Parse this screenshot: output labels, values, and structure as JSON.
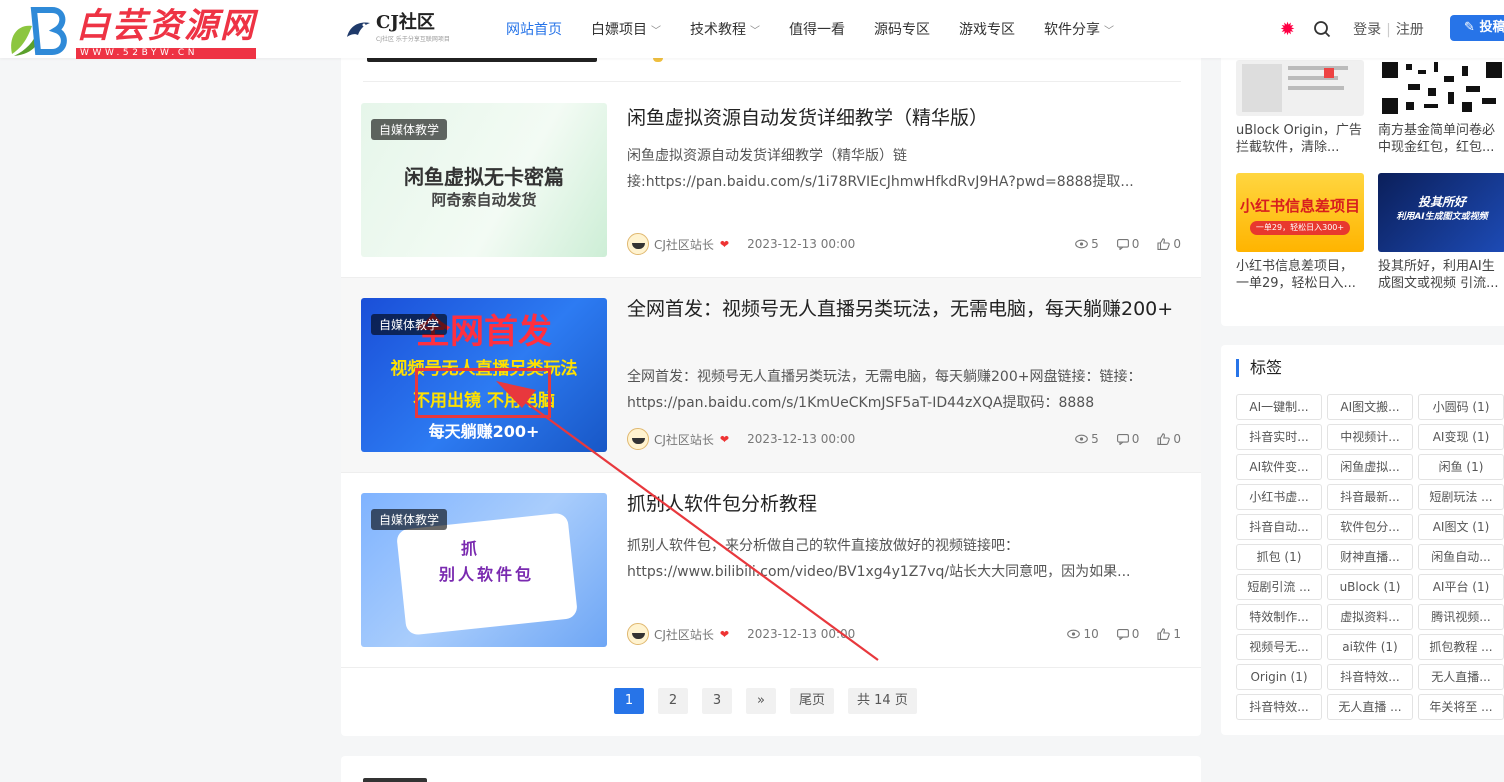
{
  "watermark": {
    "title": "白芸资源网",
    "url": "WWW.52BYW.CN"
  },
  "site": {
    "name": "CJ社区",
    "tagline": "CJ社区 乐于分享互联网项目"
  },
  "nav": {
    "items": [
      {
        "label": "网站首页",
        "dropdown": false
      },
      {
        "label": "白嫖项目",
        "dropdown": true
      },
      {
        "label": "技术教程",
        "dropdown": true
      },
      {
        "label": "值得一看",
        "dropdown": false
      },
      {
        "label": "源码专区",
        "dropdown": false
      },
      {
        "label": "游戏专区",
        "dropdown": false
      },
      {
        "label": "软件分享",
        "dropdown": true
      }
    ]
  },
  "header": {
    "login": "登录",
    "register": "注册",
    "post_button": "投稿"
  },
  "posts": [
    {
      "category": "自媒体教学",
      "thumb_line1": "闲鱼虚拟无卡密篇",
      "thumb_line2": "阿奇索自动发货",
      "title": "闲鱼虚拟资源自动发货详细教学（精华版）",
      "excerpt": "闲鱼虚拟资源自动发货详细教学（精华版）链接:https://pan.baidu.com/s/1i78RVIEcJhmwHfkdRvJ9HA?pwd=8888提取...",
      "author": "CJ社区站长",
      "date": "2023-12-13 00:00",
      "views": "5",
      "comments": "0",
      "likes": "0"
    },
    {
      "category": "自媒体教学",
      "thumb_line1": "全网首发",
      "thumb_line2": "视频号无人直播另类玩法",
      "thumb_line3": "不用出镜 不用电脑",
      "thumb_line4": "每天躺赚200+",
      "title": "全网首发：视频号无人直播另类玩法，无需电脑，每天躺赚200+",
      "excerpt": "全网首发：视频号无人直播另类玩法，无需电脑，每天躺赚200+网盘链接：链接：https://pan.baidu.com/s/1KmUeCKmJSF5aT-ID44zXQA提取码：8888",
      "author": "CJ社区站长",
      "date": "2023-12-13 00:00",
      "views": "5",
      "comments": "0",
      "likes": "0"
    },
    {
      "category": "自媒体教学",
      "thumb_line1": "抓",
      "thumb_line2": "别人软件包",
      "title": "抓别人软件包分析教程",
      "excerpt": "抓别人软件包，来分析做自己的软件直接放做好的视频链接吧：https://www.bilibili.com/video/BV1xg4y1Z7vq/站长大大同意吧，因为如果...",
      "author": "CJ社区站长",
      "date": "2023-12-13 00:00",
      "views": "10",
      "comments": "0",
      "likes": "1"
    }
  ],
  "pagination": {
    "pages": [
      "1",
      "2",
      "3"
    ],
    "next": "»",
    "last": "尾页",
    "total": "共 14 页",
    "current": "1"
  },
  "sidebar": {
    "related": [
      {
        "title": "uBlock Origin，广告拦截软件，清除..."
      },
      {
        "title": "南方基金简单问卷必中现金红包，红包..."
      },
      {
        "title": "小红书信息差项目，一单29，轻松日入...",
        "img_text": "小红书信息差项目",
        "img_sub": "一单29，轻松日入300+"
      },
      {
        "title": "投其所好，利用AI生成图文或视频 引流...",
        "img_text": "投其所好",
        "img_sub": "利用AI生成图文或视频"
      }
    ],
    "tags_title": "标签",
    "tags": [
      "AI一键制...",
      "AI图文搬...",
      "小圆码 (1)",
      "抖音实时...",
      "中视频计...",
      "AI变现 (1)",
      "AI软件变...",
      "闲鱼虚拟...",
      "闲鱼 (1)",
      "小红书虚...",
      "抖音最新...",
      "短剧玩法 ...",
      "抖音自动...",
      "软件包分...",
      "AI图文 (1)",
      "抓包 (1)",
      "财神直播...",
      "闲鱼自动...",
      "短剧引流 ...",
      "uBlock (1)",
      "AI平台 (1)",
      "特效制作...",
      "虚拟资料...",
      "腾讯视频...",
      "视频号无...",
      "ai软件 (1)",
      "抓包教程 ...",
      "Origin (1)",
      "抖音特效...",
      "无人直播...",
      "抖音特效...",
      "无人直播 ...",
      "年关将至 ..."
    ]
  },
  "colors": {
    "accent": "#2774e8",
    "watermark": "#ee3344",
    "arrow": "#e8383d"
  }
}
